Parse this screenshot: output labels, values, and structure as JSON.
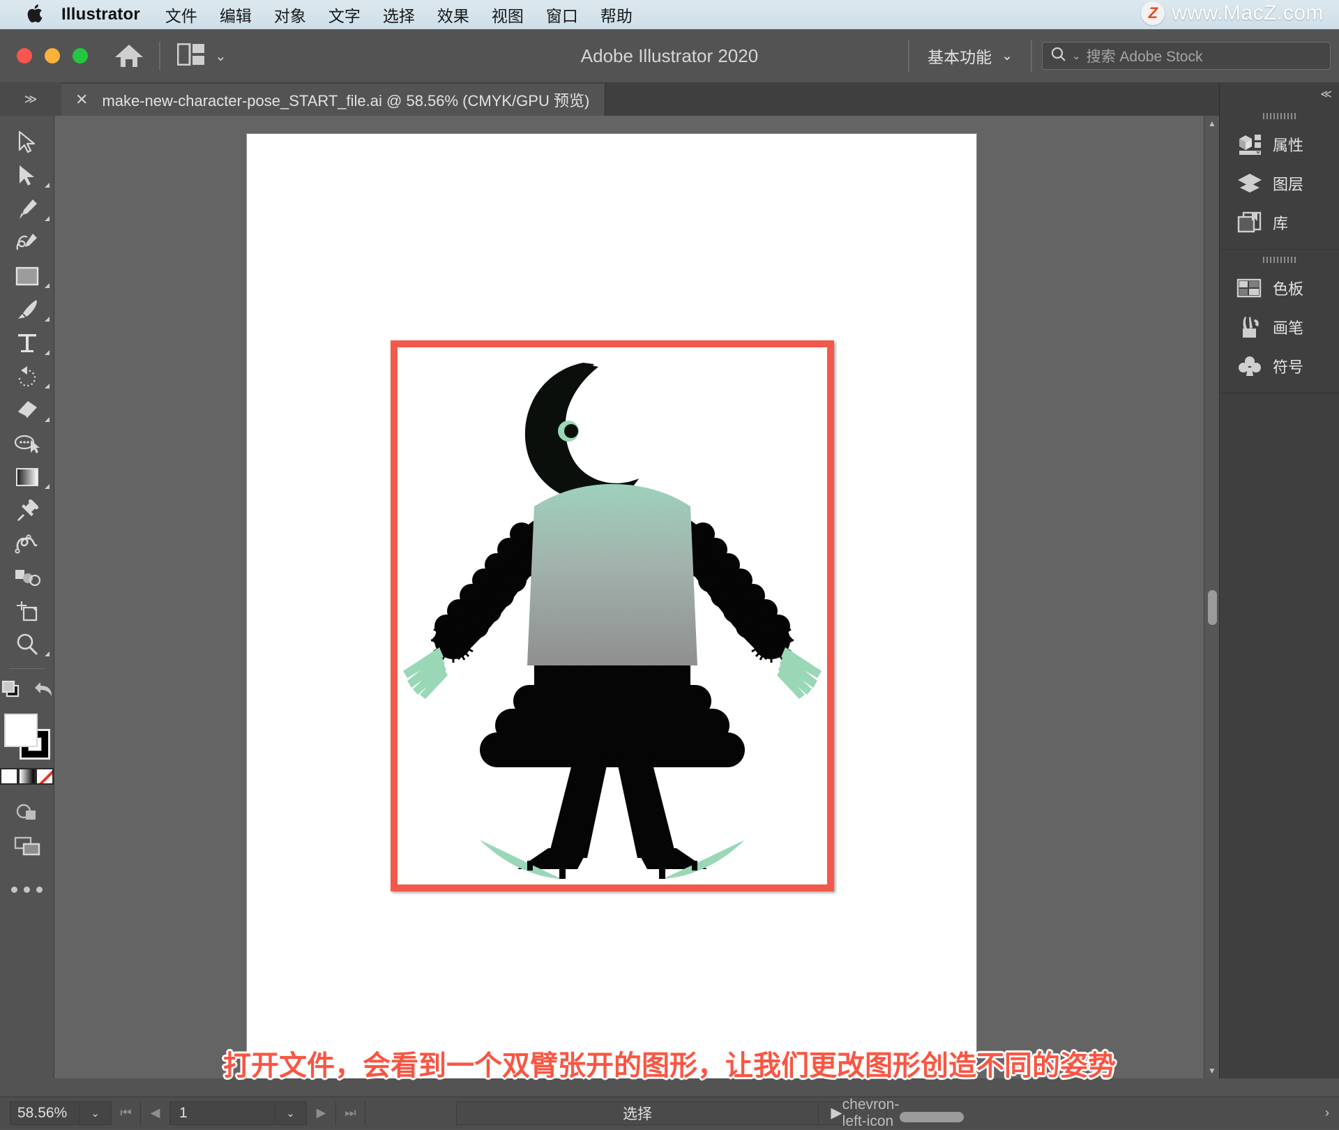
{
  "mac_menu": {
    "apple_icon": "apple-logo",
    "app_name": "Illustrator",
    "items": [
      "文件",
      "编辑",
      "对象",
      "文字",
      "选择",
      "效果",
      "视图",
      "窗口",
      "帮助"
    ],
    "watermark": {
      "badge": "Z",
      "text": "www.MacZ.com"
    }
  },
  "appbar": {
    "title": "Adobe Illustrator 2020",
    "home_icon": "home-icon",
    "arrange_icon": "arrange-documents-icon",
    "arrange_caret": "⌄",
    "workspace": {
      "label": "基本功能",
      "caret": "⌄"
    },
    "search": {
      "icon": "search-icon",
      "caret": "⌄",
      "placeholder": "搜索 Adobe Stock",
      "value": ""
    }
  },
  "tabbar": {
    "collapse_left": "≫",
    "collapse_right": "≪",
    "close_glyph": "✕",
    "document_tab": "make-new-character-pose_START_file.ai @ 58.56% (CMYK/GPU 预览)"
  },
  "tools": [
    {
      "name": "selection-tool",
      "has_flyout": false
    },
    {
      "name": "direct-selection-tool",
      "has_flyout": true
    },
    {
      "name": "pen-tool",
      "has_flyout": true
    },
    {
      "name": "curvature-tool",
      "has_flyout": false
    },
    {
      "name": "rectangle-tool",
      "has_flyout": true
    },
    {
      "name": "paintbrush-tool",
      "has_flyout": true
    },
    {
      "name": "type-tool",
      "has_flyout": true
    },
    {
      "name": "rotate-tool",
      "has_flyout": true
    },
    {
      "name": "eraser-tool",
      "has_flyout": true
    },
    {
      "name": "shape-builder-tool",
      "has_flyout": false
    },
    {
      "name": "gradient-tool",
      "has_flyout": true
    },
    {
      "name": "eyedropper-tool",
      "has_flyout": false
    },
    {
      "name": "blend-tool",
      "has_flyout": false
    },
    {
      "name": "symbol-sprayer-tool",
      "has_flyout": false
    },
    {
      "name": "artboard-tool",
      "has_flyout": false
    },
    {
      "name": "zoom-tool",
      "has_flyout": true
    }
  ],
  "tool_footer": {
    "arrange_icon": "arrange-objects-icon",
    "undo_icon": "undo-arrow-icon",
    "fill_color": "#ffffff",
    "stroke_color": "#000000",
    "mini_swatches": [
      "color-swatch",
      "gradient-swatch",
      "none-swatch"
    ],
    "change_screen_icon": "screen-mode-icon",
    "drawing_mode_icon": "drawing-mode-icon",
    "more_tools": "•••"
  },
  "right_dock": {
    "collapse_glyph": "≪",
    "groups": [
      {
        "items": [
          {
            "label": "属性",
            "icon": "properties-icon"
          },
          {
            "label": "图层",
            "icon": "layers-icon"
          },
          {
            "label": "库",
            "icon": "libraries-icon"
          }
        ]
      },
      {
        "items": [
          {
            "label": "色板",
            "icon": "swatches-icon"
          },
          {
            "label": "画笔",
            "icon": "brushes-icon"
          },
          {
            "label": "符号",
            "icon": "symbols-icon"
          }
        ]
      }
    ]
  },
  "artwork": {
    "frame_color": "#f2594a",
    "body_gradient_top": "#9ed5c0",
    "body_gradient_bottom": "#9a9a9a",
    "limb_color": "#000000",
    "hand_color": "#9ad7b7",
    "eye_color": "#9ad7b7",
    "description": "双臂张开的人物图形"
  },
  "caption": "打开文件，会看到一个双臂张开的图形，让我们更改图形创造不同的姿势",
  "statusbar": {
    "zoom": "58.56%",
    "zoom_caret": "⌄",
    "first_page_icon": "first-page-icon",
    "prev_page_icon": "prev-page-icon",
    "page": "1",
    "page_caret": "⌄",
    "next_page_icon": "next-page-icon",
    "last_page_icon": "last-page-icon",
    "status_text": "选择",
    "play_icon": "play-icon",
    "left_icon": "chevron-left-icon",
    "right_icon": "chevron-right-icon"
  }
}
